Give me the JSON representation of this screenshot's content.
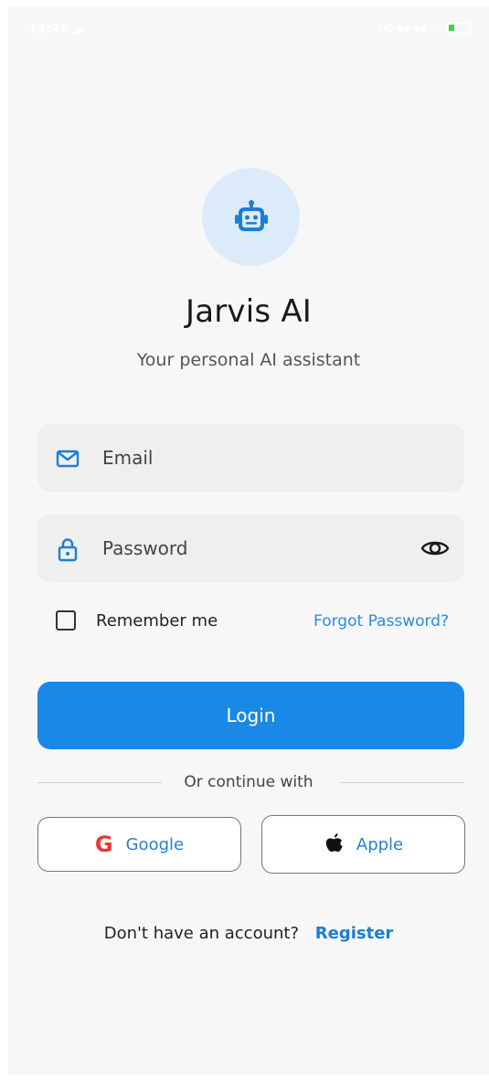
{
  "status_bar": {
    "time": "11:46",
    "left_icon": "cloud-icon",
    "right_indicators": "HD ■■ ■■"
  },
  "app": {
    "logo_icon": "robot-icon",
    "title": "Jarvis AI",
    "subtitle": "Your personal AI assistant"
  },
  "form": {
    "email_placeholder": "Email",
    "password_placeholder": "Password",
    "remember_label": "Remember me",
    "forgot_label": "Forgot Password?",
    "login_label": "Login"
  },
  "divider": {
    "label": "Or continue with"
  },
  "social": {
    "google_label": "Google",
    "apple_label": "Apple"
  },
  "footer": {
    "prompt": "Don't have an account?",
    "register_label": "Register"
  },
  "colors": {
    "primary": "#1a88e6",
    "link": "#2a8be0",
    "background": "#f7f7f7",
    "field_background": "#efefef",
    "logo_circle": "#dcebfa",
    "google_red": "#e53935"
  }
}
